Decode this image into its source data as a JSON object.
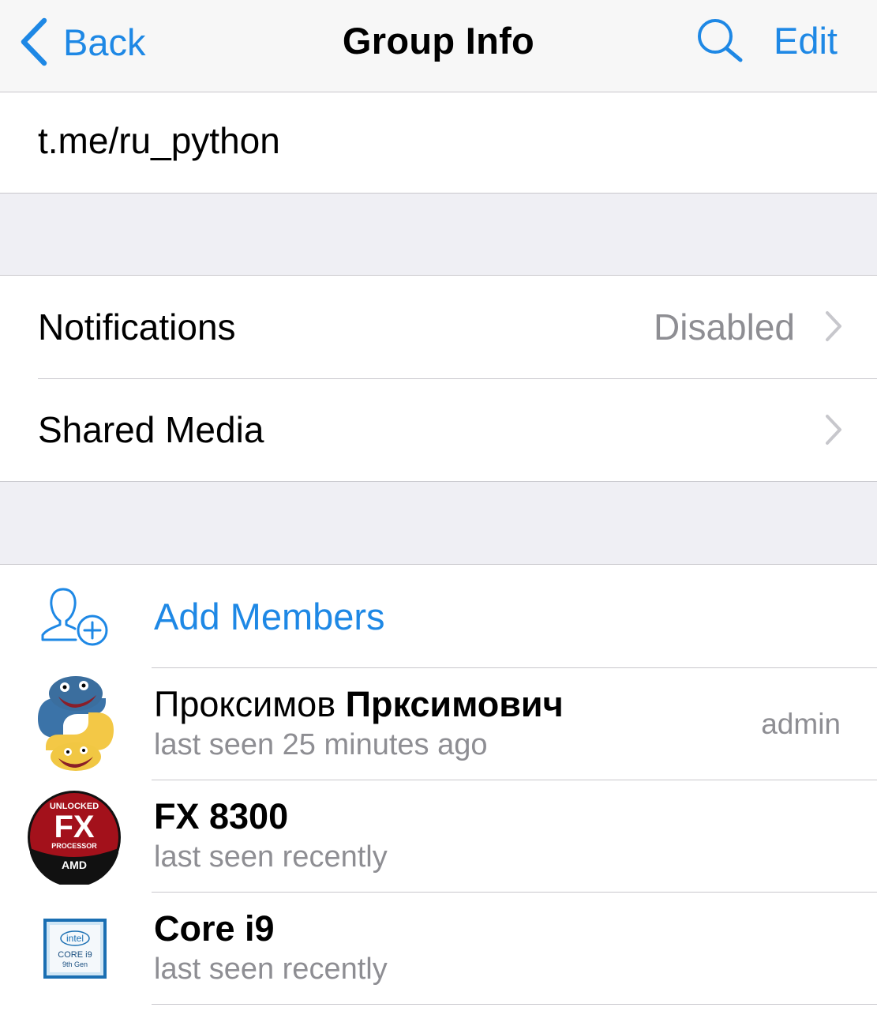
{
  "nav": {
    "back_label": "Back",
    "title": "Group Info",
    "edit_label": "Edit"
  },
  "link": {
    "text": "t.me/ru_python"
  },
  "settings": {
    "notifications_label": "Notifications",
    "notifications_value": "Disabled",
    "shared_media_label": "Shared Media"
  },
  "members": {
    "add_label": "Add Members",
    "items": [
      {
        "first_name": "Проксимов",
        "last_name": "Прксимович",
        "status": "last seen 25 minutes ago",
        "role": "admin",
        "avatar": "python-snake-avatar"
      },
      {
        "first_name": "",
        "last_name": "FX 8300",
        "status": "last seen recently",
        "role": "",
        "avatar": "amd-fx-logo-avatar",
        "badge_lines": [
          "UNLOCKED",
          "FX",
          "PROCESSOR",
          "AMD"
        ]
      },
      {
        "first_name": "",
        "last_name": "Core i9",
        "status": "last seen recently",
        "role": "",
        "avatar": "intel-core-i9-avatar",
        "badge_lines": [
          "intel",
          "CORE i9",
          "9th Gen"
        ]
      }
    ]
  },
  "colors": {
    "accent": "#1e88e5",
    "secondary_text": "#8e8e93",
    "background": "#efeff4",
    "separator": "#c8c7cc"
  },
  "icons": {
    "back": "chevron-left-icon",
    "search": "search-icon",
    "disclosure": "chevron-right-icon",
    "add_member": "add-user-icon"
  }
}
